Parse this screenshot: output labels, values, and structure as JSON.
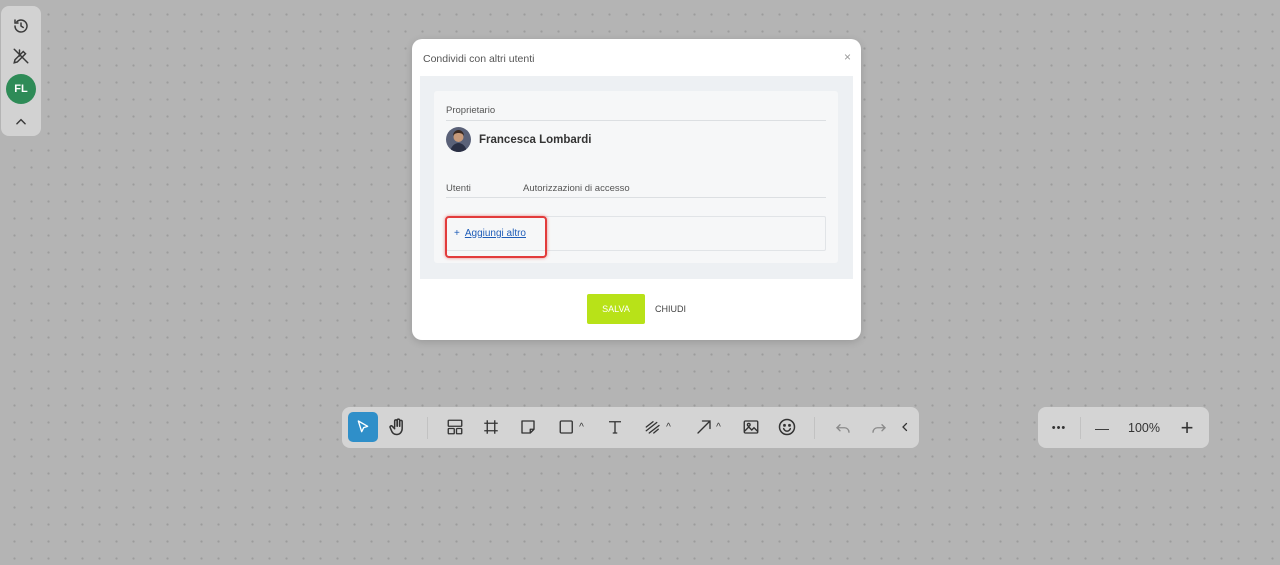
{
  "left_bar": {
    "icons": [
      "history-icon",
      "pen-off-icon",
      "collapse-icon"
    ],
    "user_initials": "FL",
    "user_color": "#2e8b57"
  },
  "dialog": {
    "title": "Condividi con altri utenti",
    "close_glyph": "×",
    "owner_label": "Proprietario",
    "owner_name": "Francesca Lombardi",
    "columns": [
      "Utenti",
      "Autorizzazioni di accesso"
    ],
    "add_plus": "+",
    "add_label": "Aggiungi altro",
    "save_label": "SALVA",
    "close_label": "CHIUDI",
    "accent": "#b8e218",
    "link_color": "#1f5db8",
    "highlight_color": "#e23b3b"
  },
  "toolbar": {
    "tools": [
      "select",
      "hand",
      "templates",
      "frame",
      "sticky-note",
      "shape",
      "text",
      "pen",
      "arrow",
      "image",
      "emoji",
      "undo",
      "redo",
      "collapse"
    ],
    "active_tool": "select",
    "active_color": "#2f8fc9"
  },
  "zoom": {
    "more_glyph": "•••",
    "minus_glyph": "—",
    "level": "100%",
    "plus_glyph": "+"
  }
}
